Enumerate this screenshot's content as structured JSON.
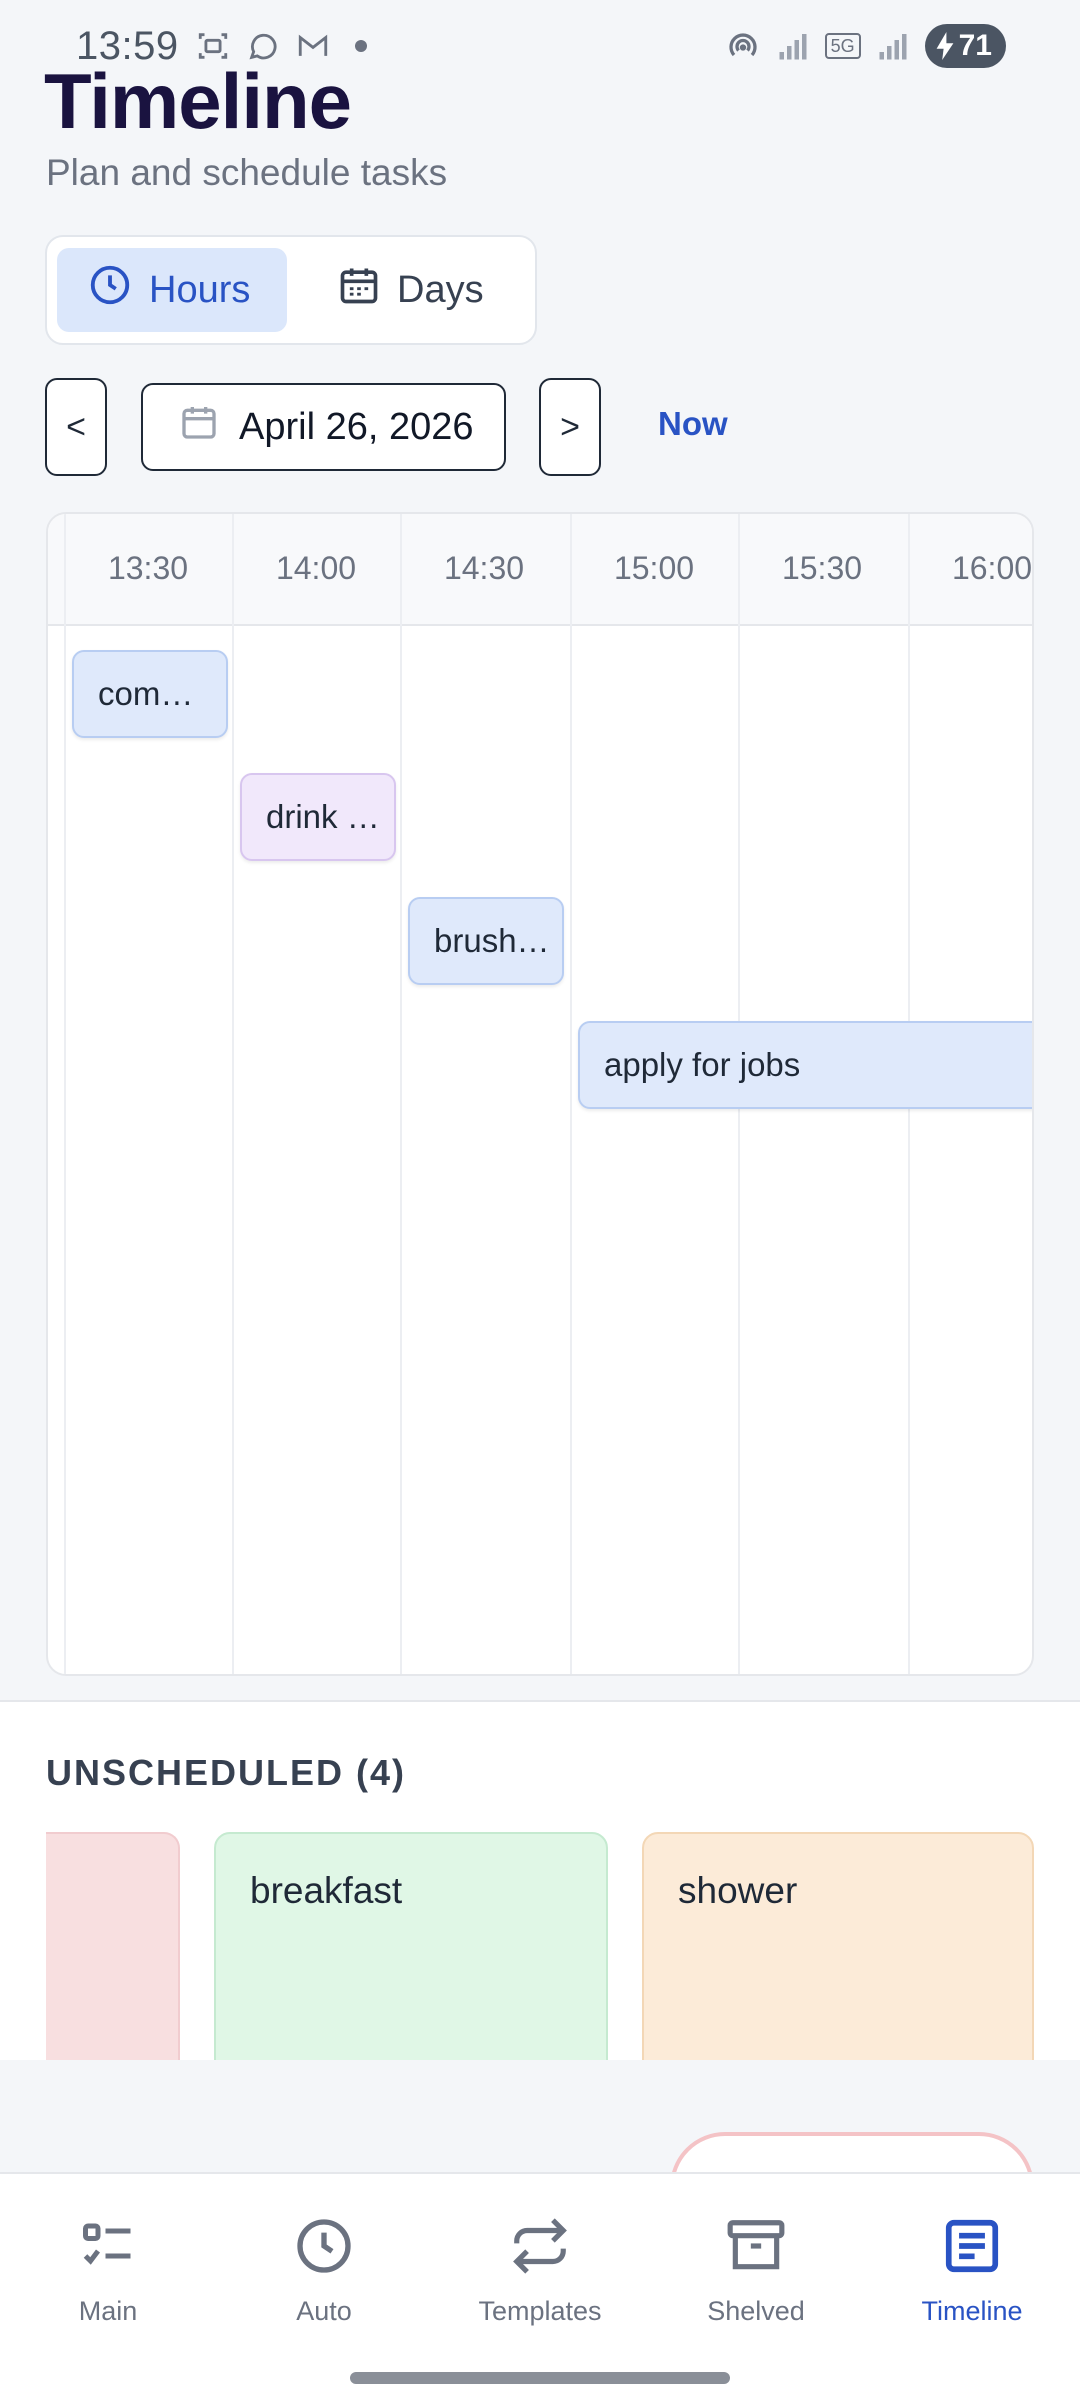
{
  "status_bar": {
    "time": "13:59",
    "battery": "71",
    "network": "5G"
  },
  "header": {
    "title": "Timeline",
    "subtitle": "Plan and schedule tasks"
  },
  "view_toggle": {
    "options": [
      {
        "label": "Hours",
        "icon": "clock-icon",
        "active": true
      },
      {
        "label": "Days",
        "icon": "calendar-icon",
        "active": false
      }
    ]
  },
  "date_nav": {
    "prev_label": "<",
    "next_label": ">",
    "date": "April 26, 2026",
    "now_label": "Now"
  },
  "timeline": {
    "time_slots": [
      "13:30",
      "14:00",
      "14:30",
      "15:00",
      "15:30",
      "16:00"
    ],
    "tasks": [
      {
        "label": "com…",
        "color": "#dfe9fb"
      },
      {
        "label": "drink …",
        "color": "#f1e8fb"
      },
      {
        "label": "brush…",
        "color": "#dfe9fb"
      },
      {
        "label": "apply for jobs",
        "color": "#dfe9fb"
      }
    ]
  },
  "unscheduled": {
    "heading": "UNSCHEDULED (4)",
    "cards": [
      {
        "label": "",
        "color": "#f8dfe0"
      },
      {
        "label": "breakfast",
        "color": "#e0f7e6"
      },
      {
        "label": "shower",
        "color": "#fcebd8"
      }
    ]
  },
  "bottom_nav": {
    "items": [
      {
        "label": "Main",
        "icon": "checklist-icon",
        "active": false
      },
      {
        "label": "Auto",
        "icon": "clock-icon",
        "active": false
      },
      {
        "label": "Templates",
        "icon": "repeat-icon",
        "active": false
      },
      {
        "label": "Shelved",
        "icon": "archive-icon",
        "active": false
      },
      {
        "label": "Timeline",
        "icon": "timeline-doc-icon",
        "active": true
      }
    ]
  },
  "colors": {
    "accent": "#2953c4",
    "title": "#1a1340"
  }
}
